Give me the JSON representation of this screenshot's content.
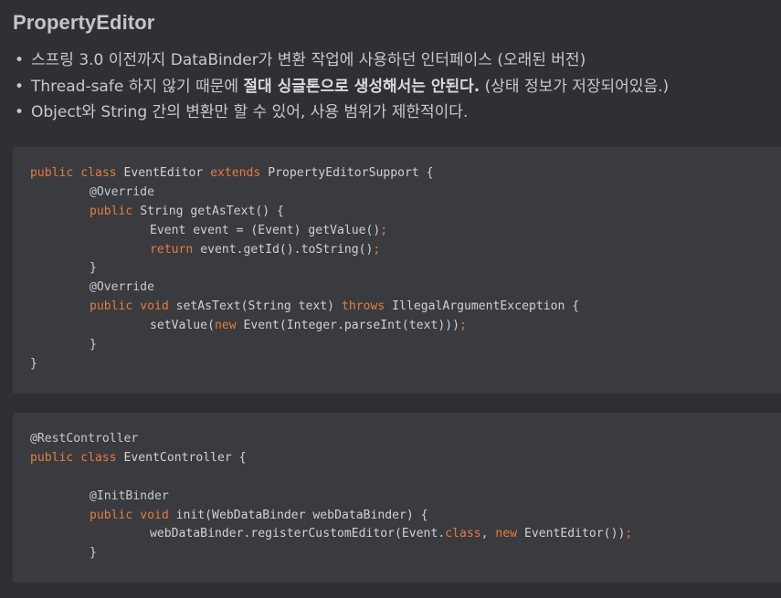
{
  "title": "PropertyEditor",
  "bullets": [
    {
      "text": "스프링 3.0 이전까지 DataBinder가 변환 작업에 사용하던 인터페이스 (오래된 버전)"
    },
    {
      "before": "Thread-safe 하지 않기 때문에 ",
      "strong": "절대 싱글톤으로 생성해서는 안된다.",
      "after": " (상태 정보가 저장되어있음.)"
    },
    {
      "text": "Object와 String 간의 변환만 할 수 있어, 사용 범위가 제한적이다."
    }
  ],
  "code1": {
    "l1": {
      "kw1": "public",
      "kw2": "class",
      "t1": "EventEditor",
      "kw3": "extends",
      "t2": "PropertyEditorSupport {"
    },
    "l2": {
      "ann": "@Override"
    },
    "l3": {
      "kw1": "public",
      "t1": "String getAsText() {"
    },
    "l4": {
      "t1": "Event event = (Event) getValue()",
      "semi": ";"
    },
    "l5": {
      "kw1": "return",
      "t1": "event.getId().toString()",
      "semi": ";"
    },
    "l6": {
      "t1": "}"
    },
    "l7": {
      "ann": "@Override"
    },
    "l8": {
      "kw1": "public",
      "kw2": "void",
      "t1": "setAsText(String text)",
      "kw3": "throws",
      "t2": "IllegalArgumentException {"
    },
    "l9": {
      "t1": "setValue(",
      "kw1": "new",
      "t2": "Event(Integer.parseInt(text)))",
      "semi": ";"
    },
    "l10": {
      "t1": "}"
    },
    "l11": {
      "t1": "}"
    }
  },
  "code2": {
    "l1": {
      "ann": "@RestController"
    },
    "l2": {
      "kw1": "public",
      "kw2": "class",
      "t1": "EventController {"
    },
    "l3": {
      "ann": "@InitBinder"
    },
    "l4": {
      "kw1": "public",
      "kw2": "void",
      "t1": "init(WebDataBinder webDataBinder) {"
    },
    "l5": {
      "t1": "webDataBinder.registerCustomEditor(Event.",
      "kw1": "class",
      "t2": ",",
      "kw2": "new",
      "t3": "EventEditor())",
      "semi": ";"
    },
    "l6": {
      "t1": "}"
    }
  },
  "colors": {
    "background": "#2f3033",
    "code_background": "#3a3b3e",
    "keyword": "#e57d3c",
    "text": "#cfd1d3"
  }
}
